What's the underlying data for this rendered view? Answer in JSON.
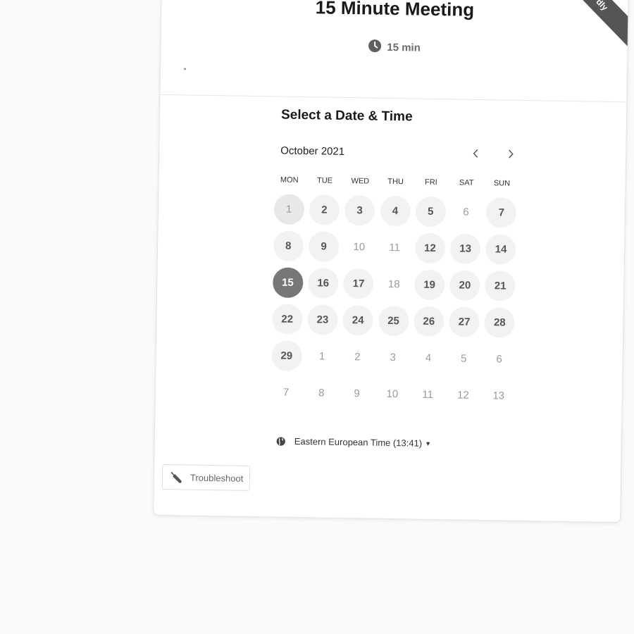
{
  "event": {
    "title": "15 Minute Meeting",
    "duration": "15 min",
    "badge": "dly"
  },
  "calendar": {
    "heading": "Select a Date & Time",
    "month": "October 2021",
    "weekdays": [
      "MON",
      "TUE",
      "WED",
      "THU",
      "FRI",
      "SAT",
      "SUN"
    ],
    "days": [
      {
        "n": "1",
        "s": "today"
      },
      {
        "n": "2",
        "s": "avail"
      },
      {
        "n": "3",
        "s": "avail"
      },
      {
        "n": "4",
        "s": "avail"
      },
      {
        "n": "5",
        "s": "avail"
      },
      {
        "n": "6",
        "s": "muted"
      },
      {
        "n": "7",
        "s": "avail"
      },
      {
        "n": "8",
        "s": "avail"
      },
      {
        "n": "9",
        "s": "avail"
      },
      {
        "n": "10",
        "s": "muted"
      },
      {
        "n": "11",
        "s": "muted"
      },
      {
        "n": "12",
        "s": "avail"
      },
      {
        "n": "13",
        "s": "avail"
      },
      {
        "n": "14",
        "s": "avail"
      },
      {
        "n": "15",
        "s": "selected"
      },
      {
        "n": "16",
        "s": "avail"
      },
      {
        "n": "17",
        "s": "avail"
      },
      {
        "n": "18",
        "s": "muted"
      },
      {
        "n": "19",
        "s": "avail"
      },
      {
        "n": "20",
        "s": "avail"
      },
      {
        "n": "21",
        "s": "avail"
      },
      {
        "n": "22",
        "s": "avail"
      },
      {
        "n": "23",
        "s": "avail"
      },
      {
        "n": "24",
        "s": "avail"
      },
      {
        "n": "25",
        "s": "avail"
      },
      {
        "n": "26",
        "s": "avail"
      },
      {
        "n": "27",
        "s": "avail"
      },
      {
        "n": "28",
        "s": "avail"
      },
      {
        "n": "29",
        "s": "avail"
      },
      {
        "n": "1",
        "s": "muted"
      },
      {
        "n": "2",
        "s": "muted"
      },
      {
        "n": "3",
        "s": "muted"
      },
      {
        "n": "4",
        "s": "muted"
      },
      {
        "n": "5",
        "s": "muted"
      },
      {
        "n": "6",
        "s": "muted"
      },
      {
        "n": "7",
        "s": "muted"
      },
      {
        "n": "8",
        "s": "muted"
      },
      {
        "n": "9",
        "s": "muted"
      },
      {
        "n": "10",
        "s": "muted"
      },
      {
        "n": "11",
        "s": "muted"
      },
      {
        "n": "12",
        "s": "muted"
      },
      {
        "n": "13",
        "s": "muted"
      }
    ]
  },
  "timezone": {
    "label": "Eastern European Time (13:41)"
  },
  "troubleshoot": {
    "label": "Troubleshoot"
  },
  "icons": {
    "duration": "clock-icon",
    "prev": "chevron-left-icon",
    "next": "chevron-right-icon",
    "timezone": "globe-icon",
    "timezone_dropdown": "caret-down-icon",
    "troubleshoot": "wrench-icon"
  },
  "colors": {
    "selected": "#777777",
    "available": "#f2f2f2",
    "ribbon": "#555555"
  }
}
